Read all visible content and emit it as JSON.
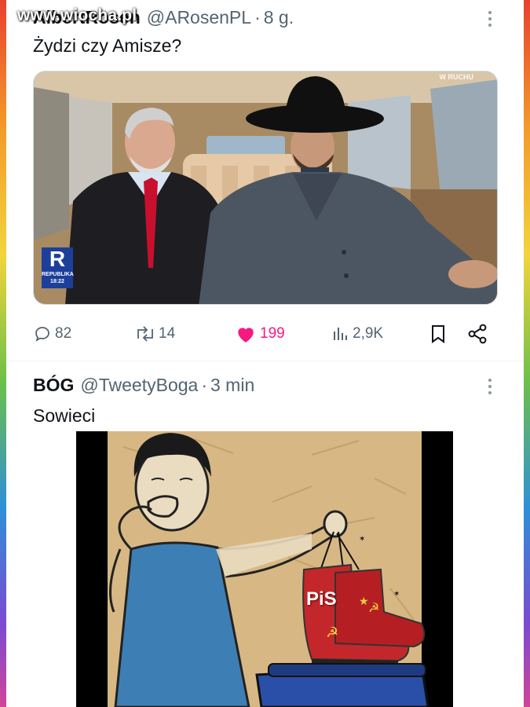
{
  "watermark": "www.wiocha.pl",
  "tweet1": {
    "author_name": "AlbertRosen",
    "handle": "@ARosenPL",
    "separator": "·",
    "time": "8 g.",
    "text": "Żydzi czy Amisze?",
    "media": {
      "channel_logo_letter": "R",
      "channel_logo_name": "REPUBLIKA",
      "clock": "18:22",
      "tag": "W RUCHU"
    },
    "actions": {
      "replies": "82",
      "retweets": "14",
      "likes": "199",
      "views": "2,9K"
    }
  },
  "tweet2": {
    "author_name": "BÓG",
    "handle": "@TweetyBoga",
    "separator": "·",
    "time": "3 min",
    "text": "Sowieci",
    "media": {
      "boot_label": "PiS"
    }
  },
  "colors": {
    "like_pink": "#f91880",
    "meta_gray": "#536471"
  }
}
